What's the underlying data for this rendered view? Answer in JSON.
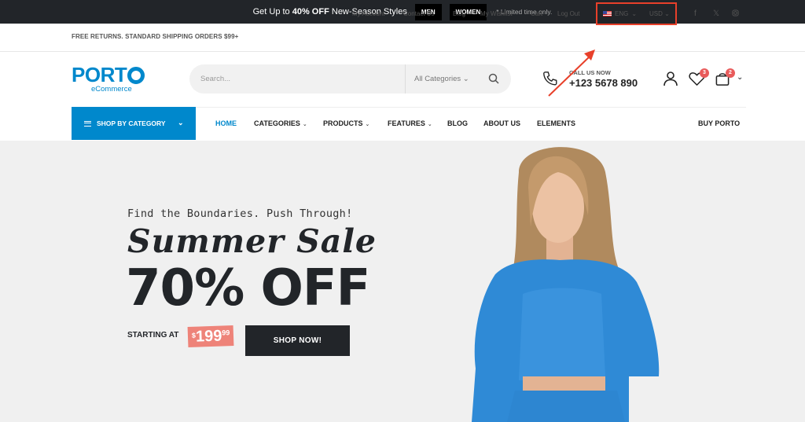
{
  "promo": {
    "pre": "Get Up to",
    "highlight": "40% OFF",
    "post": "New-Season Styles",
    "buttons": [
      "MEN",
      "WOMEN"
    ],
    "note": "* Limited time only."
  },
  "topbar": {
    "shipping": "FREE RETURNS. STANDARD SHIPPING ORDERS $99+",
    "links": [
      "My Account",
      "Contact Us",
      "Blog",
      "My Wishlist",
      "Cart",
      "Log Out"
    ],
    "language": "ENG",
    "currency": "USD",
    "social": [
      "facebook-icon",
      "x-icon",
      "instagram-icon"
    ]
  },
  "header": {
    "logo": "PORT",
    "logo_sub": "eCommerce",
    "search_placeholder": "Search...",
    "category_select": "All Categories",
    "call_label": "CALL US NOW",
    "phone": "+123 5678 890",
    "wishlist_count": "3",
    "cart_count": "2"
  },
  "nav": {
    "shop_by_category": "SHOP BY CATEGORY",
    "items": [
      {
        "label": "HOME",
        "caret": false
      },
      {
        "label": "CATEGORIES",
        "caret": true
      },
      {
        "label": "PRODUCTS",
        "caret": true
      },
      {
        "label": "FEATURES",
        "caret": true
      },
      {
        "label": "BLOG",
        "caret": false
      },
      {
        "label": "ABOUT US",
        "caret": false
      },
      {
        "label": "ELEMENTS",
        "caret": false
      }
    ],
    "buy": "BUY PORTO"
  },
  "hero": {
    "tagline": "Find the Boundaries. Push Through!",
    "title": "Summer Sale",
    "discount": "70% OFF",
    "starting": "STARTING AT",
    "price_currency": "$",
    "price_whole": "199",
    "price_cents": "99",
    "cta": "SHOP NOW!"
  },
  "colors": {
    "brand": "#0088cc",
    "dark": "#222529",
    "highlight": "#e8402a",
    "badge": "#e85b5b",
    "price_tag": "#ee8379"
  }
}
